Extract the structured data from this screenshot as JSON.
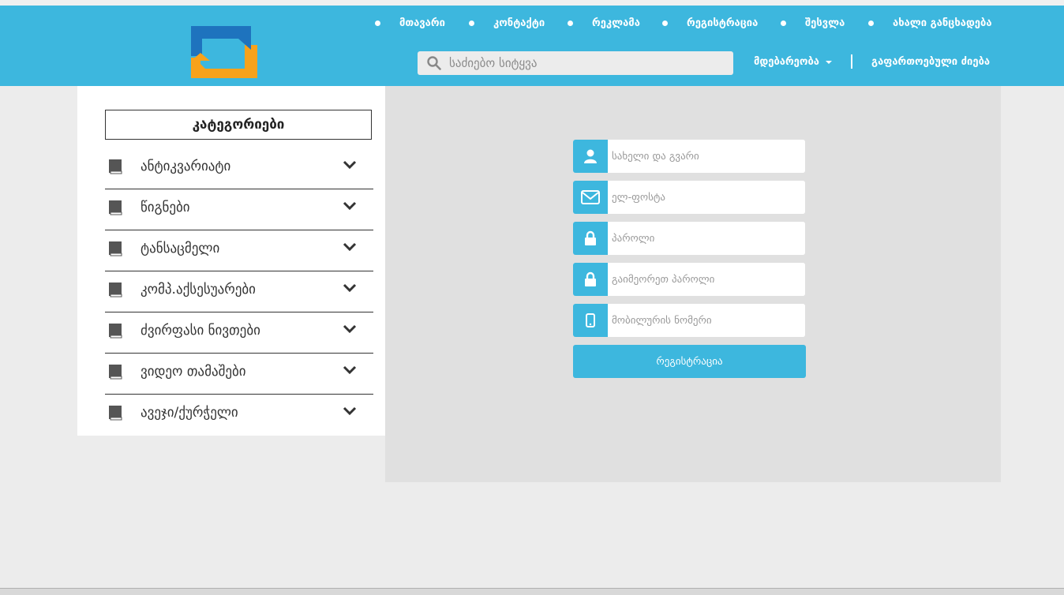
{
  "brand": {
    "accent": "#3db7de",
    "logo_orange": "#f7a21b",
    "logo_blue": "#1e73be"
  },
  "nav": {
    "items": [
      "მთავარი",
      "კონტაქტი",
      "რეკლამა",
      "რეგისტრაცია",
      "შესვლა",
      "ახალი განცხადება"
    ]
  },
  "search": {
    "placeholder": "საძიებო სიტყვა",
    "icon": "search-icon"
  },
  "subnav": {
    "location_label": "მდებარეობა",
    "advanced_search_label": "გაფართოებული ძიება"
  },
  "categories": {
    "title": "კატეგორიები",
    "items": [
      {
        "label": "ანტიკვარიატი",
        "icon": "book-icon"
      },
      {
        "label": "წიგნები",
        "icon": "book-icon"
      },
      {
        "label": "ტანსაცმელი",
        "icon": "book-icon"
      },
      {
        "label": "კომპ.აქსესუარები",
        "icon": "book-icon"
      },
      {
        "label": "ძვირფასი ნივთები",
        "icon": "book-icon"
      },
      {
        "label": "ვიდეო თამაშები",
        "icon": "book-icon"
      },
      {
        "label": "ავეჯი/ქურჭელი",
        "icon": "book-icon"
      }
    ]
  },
  "register_form": {
    "fields": [
      {
        "placeholder": "სახელი და გვარი",
        "icon": "user-icon",
        "value": ""
      },
      {
        "placeholder": "ელ-ფოსტა",
        "icon": "envelope-icon",
        "value": ""
      },
      {
        "placeholder": "პაროლი",
        "icon": "lock-icon",
        "value": ""
      },
      {
        "placeholder": "გაიმეორეთ პაროლი",
        "icon": "lock-icon",
        "value": ""
      },
      {
        "placeholder": "მობილურის ნომერი",
        "icon": "mobile-icon",
        "value": ""
      }
    ],
    "submit_label": "რეგისტრაცია"
  }
}
